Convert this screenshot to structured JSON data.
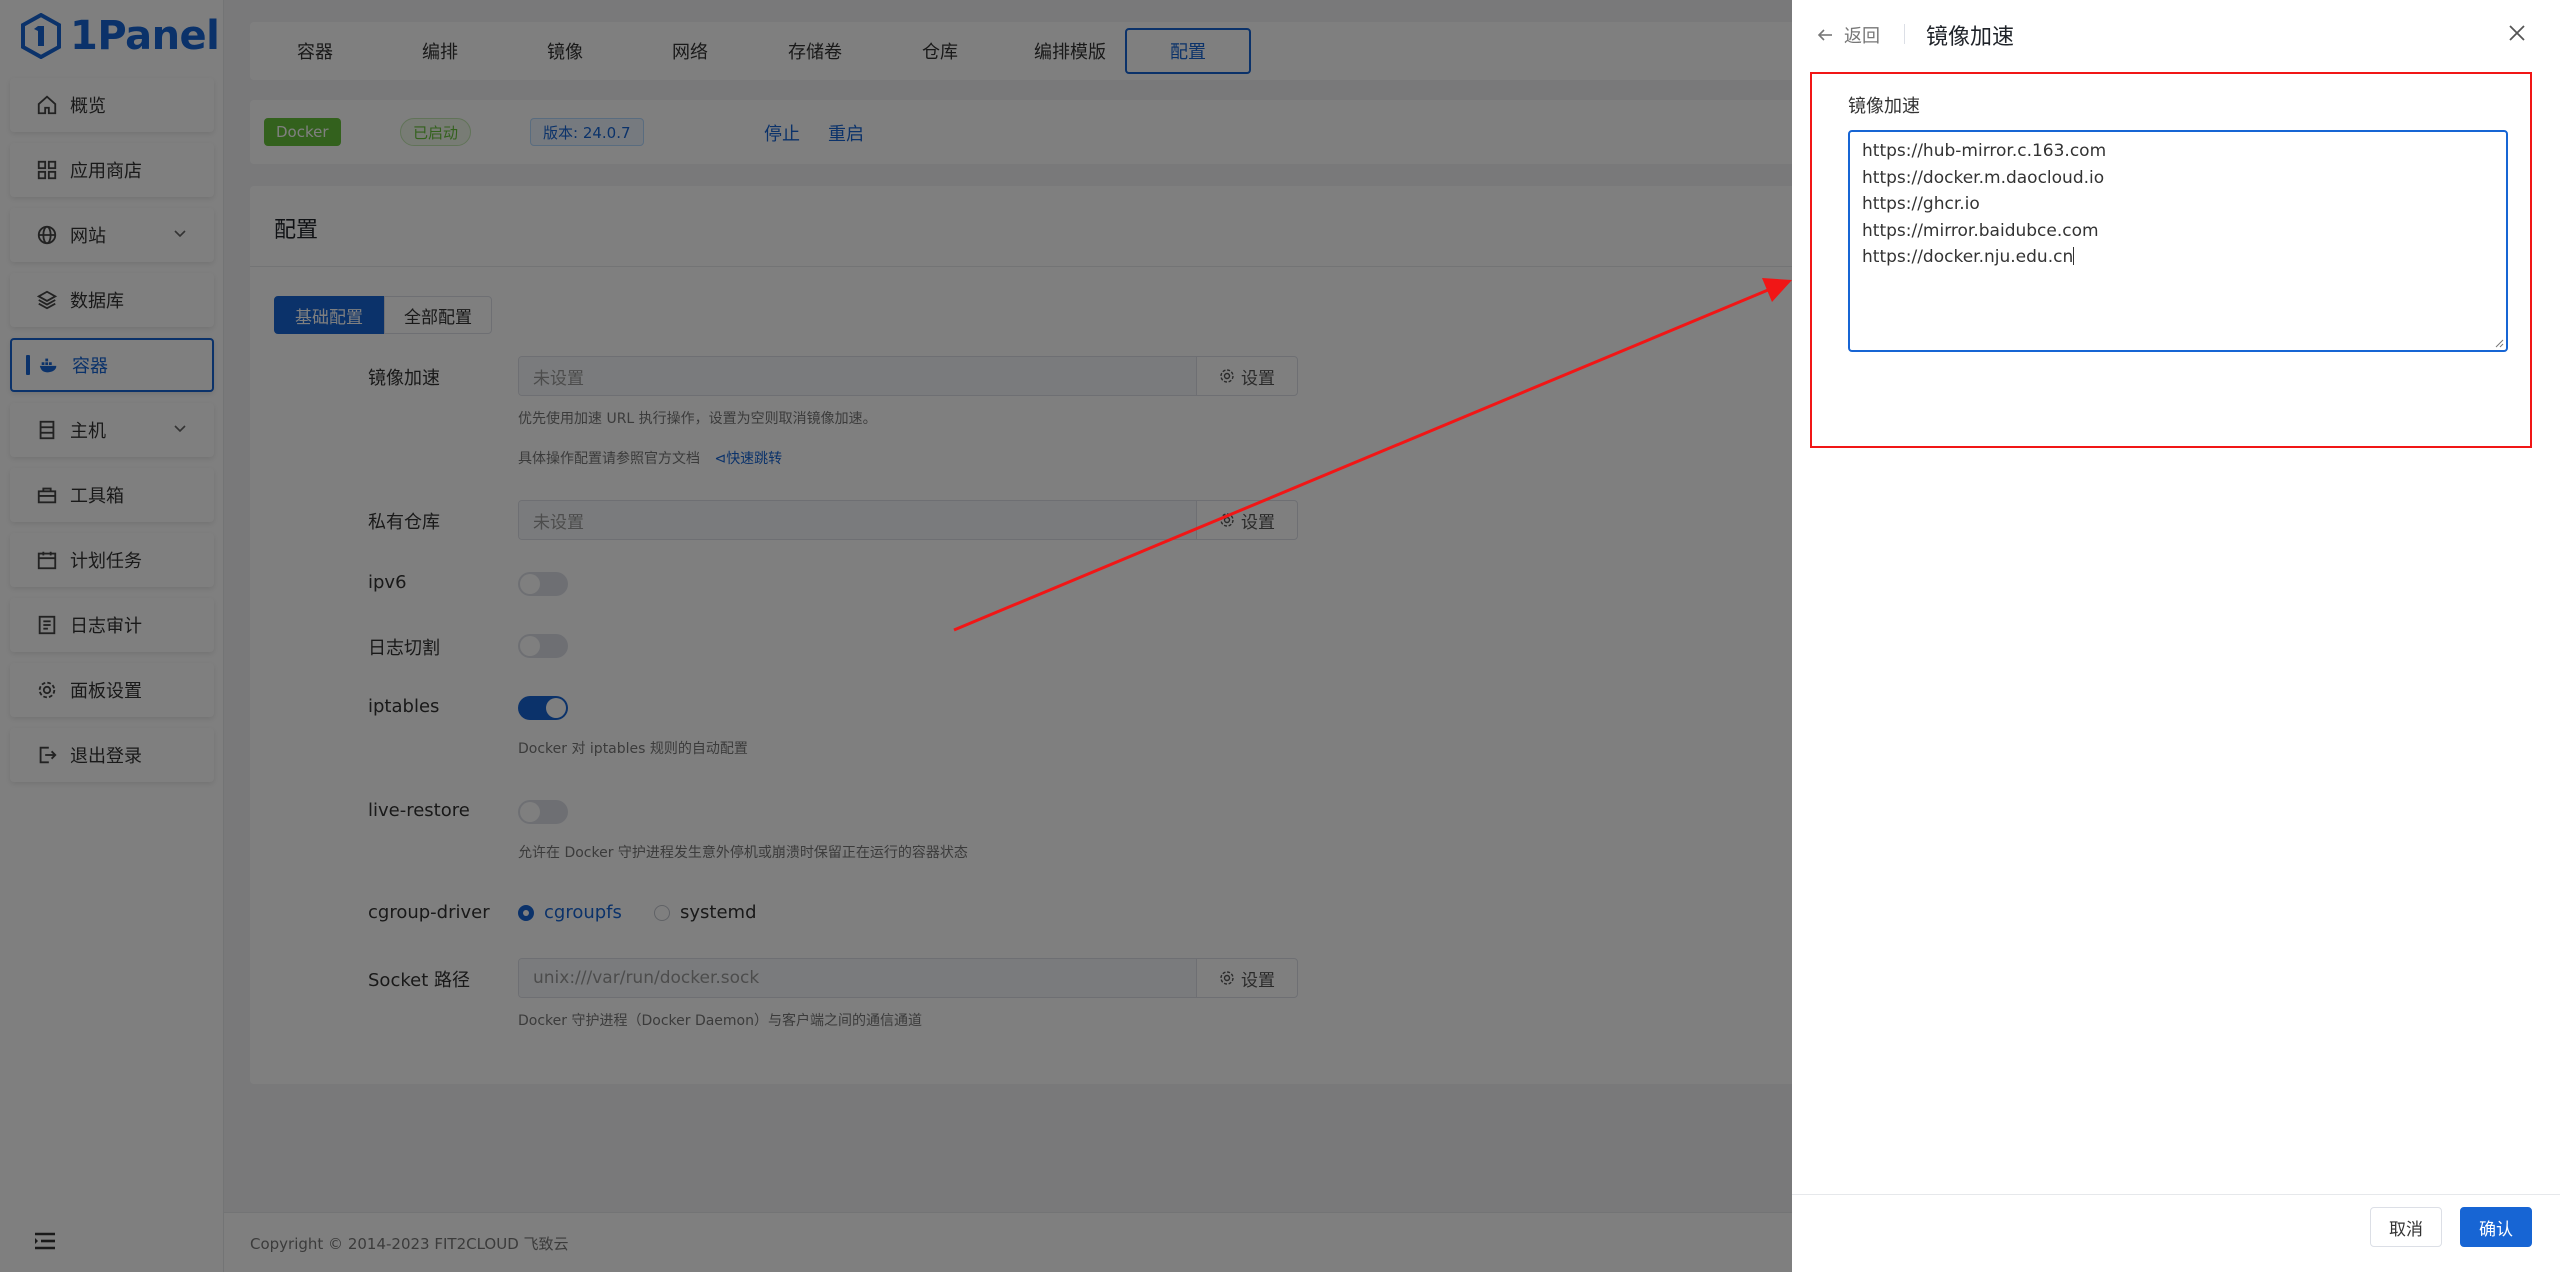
{
  "app": {
    "logo_text": "1Panel"
  },
  "sidebar": {
    "items": [
      {
        "label": "概览",
        "icon": "home-icon"
      },
      {
        "label": "应用商店",
        "icon": "grid-icon"
      },
      {
        "label": "网站",
        "icon": "globe-icon"
      },
      {
        "label": "数据库",
        "icon": "layers-icon"
      },
      {
        "label": "容器",
        "icon": "docker-icon"
      },
      {
        "label": "主机",
        "icon": "server-icon"
      },
      {
        "label": "工具箱",
        "icon": "toolbox-icon"
      },
      {
        "label": "计划任务",
        "icon": "calendar-icon"
      },
      {
        "label": "日志审计",
        "icon": "log-icon"
      },
      {
        "label": "面板设置",
        "icon": "gear-icon"
      },
      {
        "label": "退出登录",
        "icon": "logout-icon"
      }
    ],
    "active": "容器"
  },
  "tabs": [
    "容器",
    "编排",
    "镜像",
    "网络",
    "存储卷",
    "仓库",
    "编排模版",
    "配置"
  ],
  "status": {
    "docker_tag": "Docker",
    "running_tag": "已启动",
    "version_tag": "版本: 24.0.7",
    "stop": "停止",
    "restart": "重启"
  },
  "config": {
    "title": "配置",
    "seg_basic": "基础配置",
    "seg_all": "全部配置",
    "mirror": {
      "label": "镜像加速",
      "value": "未设置",
      "button": "设置",
      "help1": "优先使用加速 URL 执行操作，设置为空则取消镜像加速。",
      "help2": "具体操作配置请参照官方文档",
      "help_link": "快速跳转"
    },
    "registry": {
      "label": "私有仓库",
      "value": "未设置",
      "button": "设置"
    },
    "ipv6": {
      "label": "ipv6",
      "on": false
    },
    "log_cut": {
      "label": "日志切割",
      "on": false
    },
    "iptables": {
      "label": "iptables",
      "on": true,
      "help": "Docker 对 iptables 规则的自动配置"
    },
    "live_restore": {
      "label": "live-restore",
      "on": false,
      "help": "允许在 Docker 守护进程发生意外停机或崩溃时保留正在运行的容器状态"
    },
    "cgroup": {
      "label": "cgroup-driver",
      "options": [
        "cgroupfs",
        "systemd"
      ],
      "selected": "cgroupfs"
    },
    "socket": {
      "label": "Socket 路径",
      "value": "unix:///var/run/docker.sock",
      "button": "设置",
      "help": "Docker 守护进程（Docker Daemon）与客户端之间的通信通道"
    }
  },
  "footer": {
    "copyright": "Copyright © 2014-2023 FIT2CLOUD 飞致云"
  },
  "drawer": {
    "back": "返回",
    "title": "镜像加速",
    "field_label": "镜像加速",
    "mirrors": [
      "https://hub-mirror.c.163.com",
      "https://docker.m.daocloud.io",
      "https://ghcr.io",
      "https://mirror.baidubce.com",
      "https://docker.nju.edu.cn"
    ],
    "cancel": "取消",
    "confirm": "确认"
  },
  "colors": {
    "accent": "#1765d4",
    "annotation": "#f11616",
    "success": "#67c23a"
  }
}
